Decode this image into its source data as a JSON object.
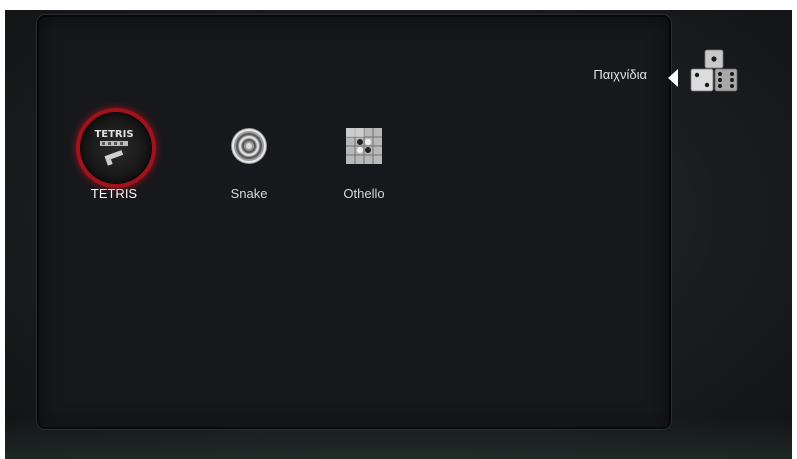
{
  "category": {
    "title": "Παιχνίδια",
    "icon": "dice-icon"
  },
  "games": [
    {
      "label": "TETRIS",
      "icon": "tetris-icon",
      "selected": true
    },
    {
      "label": "Snake",
      "icon": "snake-icon",
      "selected": false
    },
    {
      "label": "Othello",
      "icon": "othello-icon",
      "selected": false
    }
  ],
  "colors": {
    "selection_ring": "#a3121a",
    "panel": "#17181b",
    "text": "#ffffff"
  }
}
